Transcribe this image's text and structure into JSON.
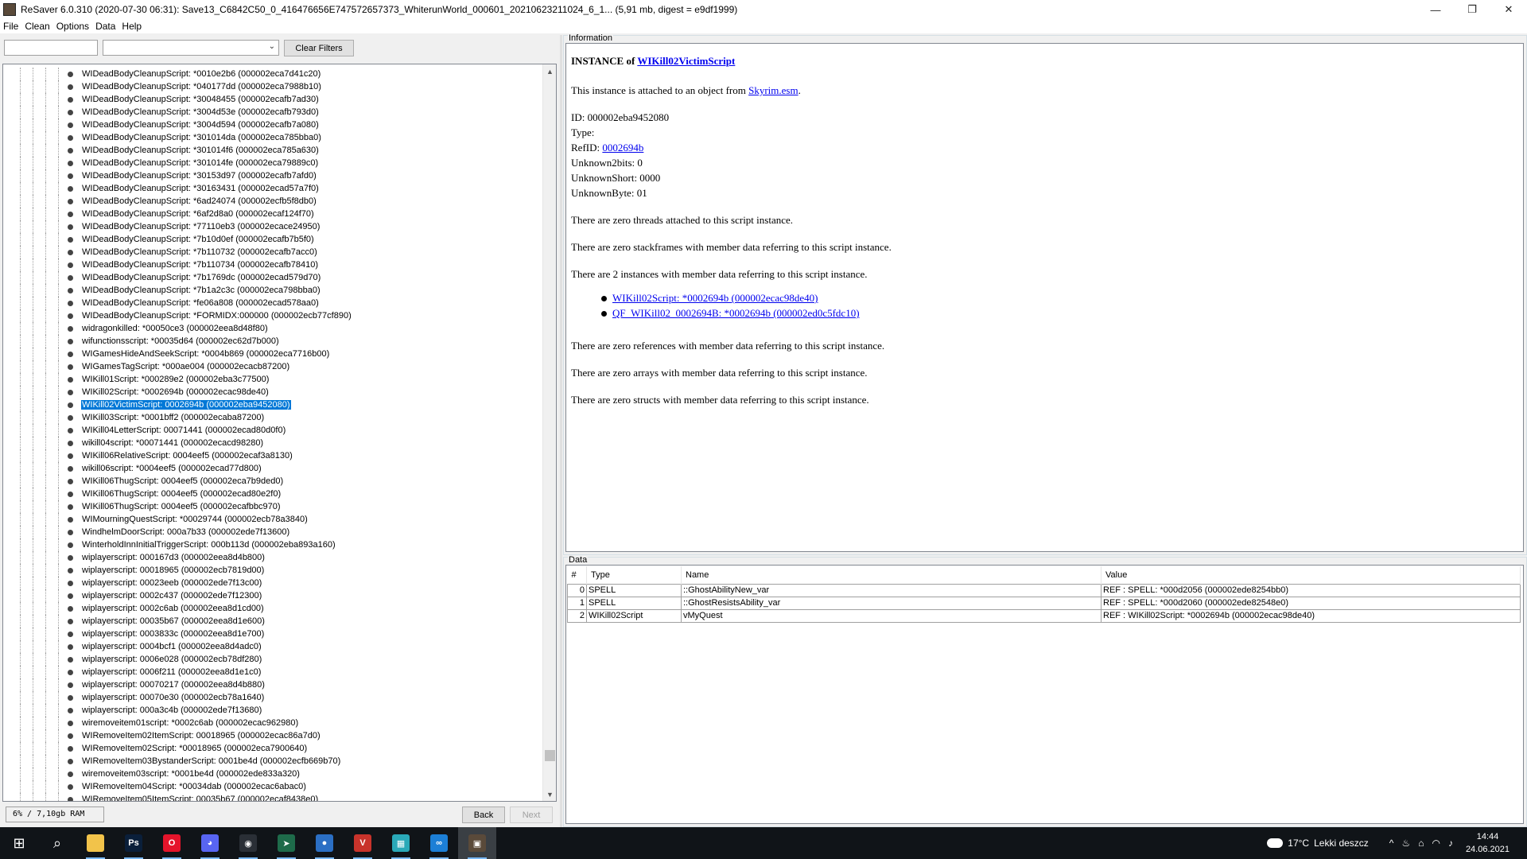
{
  "window": {
    "title": "ReSaver 6.0.310 (2020-07-30 06:31): Save13_C6842C50_0_416476656E747572657373_WhiterunWorld_000601_20210623211024_6_1... (5,91 mb, digest = e9df1999)",
    "minimize": "—",
    "maximize": "❐",
    "close": "✕"
  },
  "menu": [
    "File",
    "Clean",
    "Options",
    "Data",
    "Help"
  ],
  "filter": {
    "clear_label": "Clear Filters",
    "dropdown_icon": "chevron-down-icon"
  },
  "tree": {
    "items": [
      "WIDeadBodyCleanupScript: *0010e2b6 (000002eca7d41c20)",
      "WIDeadBodyCleanupScript: *040177dd (000002eca7988b10)",
      "WIDeadBodyCleanupScript: *30048455 (000002ecafb7ad30)",
      "WIDeadBodyCleanupScript: *3004d53e (000002ecafb793d0)",
      "WIDeadBodyCleanupScript: *3004d594 (000002ecafb7a080)",
      "WIDeadBodyCleanupScript: *301014da (000002eca785bba0)",
      "WIDeadBodyCleanupScript: *301014f6 (000002eca785a630)",
      "WIDeadBodyCleanupScript: *301014fe (000002eca79889c0)",
      "WIDeadBodyCleanupScript: *30153d97 (000002ecafb7afd0)",
      "WIDeadBodyCleanupScript: *30163431 (000002ecad57a7f0)",
      "WIDeadBodyCleanupScript: *6ad24074 (000002ecfb5f8db0)",
      "WIDeadBodyCleanupScript: *6af2d8a0 (000002ecaf124f70)",
      "WIDeadBodyCleanupScript: *77110eb3 (000002ecace24950)",
      "WIDeadBodyCleanupScript: *7b10d0ef (000002ecafb7b5f0)",
      "WIDeadBodyCleanupScript: *7b110732 (000002ecafb7acc0)",
      "WIDeadBodyCleanupScript: *7b110734 (000002ecafb78410)",
      "WIDeadBodyCleanupScript: *7b1769dc (000002ecad579d70)",
      "WIDeadBodyCleanupScript: *7b1a2c3c (000002eca798bba0)",
      "WIDeadBodyCleanupScript: *fe06a808 (000002ecad578aa0)",
      "WIDeadBodyCleanupScript: *FORMIDX:000000 (000002ecb77cf890)",
      "widragonkilled: *00050ce3 (000002eea8d48f80)",
      "wifunctionsscript: *00035d64 (000002ec62d7b000)",
      "WIGamesHideAndSeekScript: *0004b869 (000002eca7716b00)",
      "WIGamesTagScript: *000ae004 (000002ecacb87200)",
      "WIKill01Script: *000289e2 (000002eba3c77500)",
      "WIKill02Script: *0002694b (000002ecac98de40)",
      "WIKill02VictimScript: 0002694b (000002eba9452080)",
      "WIKill03Script: *0001bff2 (000002ecaba87200)",
      "WIKill04LetterScript: 00071441 (000002ecad80d0f0)",
      "wikill04script: *00071441 (000002ecacd98280)",
      "WIKill06RelativeScript: 0004eef5 (000002ecaf3a8130)",
      "wikill06script: *0004eef5 (000002ecad77d800)",
      "WIKill06ThugScript: 0004eef5 (000002eca7b9ded0)",
      "WIKill06ThugScript: 0004eef5 (000002ecad80e2f0)",
      "WIKill06ThugScript: 0004eef5 (000002ecafbbc970)",
      "WIMourningQuestScript: *00029744 (000002ecb78a3840)",
      "WindhelmDoorScript: 000a7b33 (000002ede7f13600)",
      "WinterholdInnInitialTriggerScript: 000b113d (000002eba893a160)",
      "wiplayerscript: 000167d3 (000002eea8d4b800)",
      "wiplayerscript: 00018965 (000002ecb7819d00)",
      "wiplayerscript: 00023eeb (000002ede7f13c00)",
      "wiplayerscript: 0002c437 (000002ede7f12300)",
      "wiplayerscript: 0002c6ab (000002eea8d1cd00)",
      "wiplayerscript: 00035b67 (000002eea8d1e600)",
      "wiplayerscript: 0003833c (000002eea8d1e700)",
      "wiplayerscript: 0004bcf1 (000002eea8d4adc0)",
      "wiplayerscript: 0006e028 (000002ecb78df280)",
      "wiplayerscript: 0006f211 (000002eea8d1e1c0)",
      "wiplayerscript: 00070217 (000002eea8d4b880)",
      "wiplayerscript: 00070e30 (000002ecb78a1640)",
      "wiplayerscript: 000a3c4b (000002ede7f13680)",
      "wiremoveitem01script: *0002c6ab (000002ecac962980)",
      "WIRemoveItem02ItemScript: 00018965 (000002ecac86a7d0)",
      "WIRemoveItem02Script: *00018965 (000002eca7900640)",
      "WIRemoveItem03BystanderScript: 0001be4d (000002ecfb669b70)",
      "wiremoveitem03script: *0001be4d (000002ede833a320)",
      "WIRemoveItem04Script: *00034dab (000002ecac6abac0)",
      "WIRemoveItem05ItemScript: 00035b67 (000002ecaf8438e0)"
    ],
    "selected_index": 26,
    "scroll_up": "▲",
    "scroll_down": "▼"
  },
  "status": {
    "ram": "6% / 7,10gb RAM",
    "back_label": "Back",
    "next_label": "Next"
  },
  "info": {
    "group_title": "Information",
    "instance_prefix": "INSTANCE of ",
    "instance_link": "WIKill02VictimScript",
    "attached_prefix": "This instance is attached to an object from ",
    "attached_link": "Skyrim.esm",
    "attached_suffix": ".",
    "id_line": "ID: 000002eba9452080",
    "type_line": "Type:",
    "refid_prefix": "RefID: ",
    "refid_link": "0002694b",
    "unknown2bits": "Unknown2bits: 0",
    "unknownshort": "UnknownShort: 0000",
    "unknownbyte": "UnknownByte: 01",
    "threads": "There are zero threads attached to this script instance.",
    "stackframes": "There are zero stackframes with member data referring to this script instance.",
    "instances": "There are 2 instances with member data referring to this script instance.",
    "instance_links": [
      "WIKill02Script: *0002694b (000002ecac98de40)",
      "QF_WIKill02_0002694B: *0002694b (000002ed0c5fdc10)"
    ],
    "references": "There are zero references with member data referring to this script instance.",
    "arrays": "There are zero arrays with member data referring to this script instance.",
    "structs": "There are zero structs with member data referring to this script instance."
  },
  "data_table": {
    "group_title": "Data",
    "headers": [
      "#",
      "Type",
      "Name",
      "Value"
    ],
    "rows": [
      {
        "n": "0",
        "type": "SPELL",
        "name": "::GhostAbilityNew_var",
        "value": "REF : SPELL: *000d2056 (000002ede8254bb0)"
      },
      {
        "n": "1",
        "type": "SPELL",
        "name": "::GhostResistsAbility_var",
        "value": "REF : SPELL: *000d2060 (000002ede82548e0)"
      },
      {
        "n": "2",
        "type": "WIKill02Script",
        "name": "vMyQuest",
        "value": "REF : WIKill02Script: *0002694b (000002ecac98de40)"
      }
    ]
  },
  "taskbar": {
    "apps": [
      {
        "name": "start-icon",
        "glyph": "⊞",
        "color": "#101418"
      },
      {
        "name": "search-icon",
        "glyph": "⌕",
        "color": "#101418"
      },
      {
        "name": "file-explorer-icon",
        "glyph": "",
        "color": "#f2c34a"
      },
      {
        "name": "photoshop-icon",
        "glyph": "Ps",
        "color": "#0a1f3a"
      },
      {
        "name": "opera-icon",
        "glyph": "O",
        "color": "#e5142b"
      },
      {
        "name": "discord-icon",
        "glyph": "◕",
        "color": "#5865f2"
      },
      {
        "name": "steam-icon",
        "glyph": "◉",
        "color": "#2a2f36"
      },
      {
        "name": "app-arrow-icon",
        "glyph": "➤",
        "color": "#1e6b4a"
      },
      {
        "name": "launcher-icon",
        "glyph": "●",
        "color": "#2b6fc4"
      },
      {
        "name": "voicemeeter-icon",
        "glyph": "V",
        "color": "#c8332b"
      },
      {
        "name": "mod-organizer-icon",
        "glyph": "▦",
        "color": "#2aa9b8"
      },
      {
        "name": "link-icon",
        "glyph": "∞",
        "color": "#1c7fd6"
      },
      {
        "name": "resaver-icon",
        "glyph": "▣",
        "color": "#5a4a3a"
      }
    ],
    "active_index": 12,
    "temperature": "17°C",
    "weather_text": "Lekki deszcz",
    "tray_icons": [
      "^",
      "♨",
      "⌂",
      "◠",
      "♪"
    ],
    "time": "14:44",
    "date": "24.06.2021"
  }
}
